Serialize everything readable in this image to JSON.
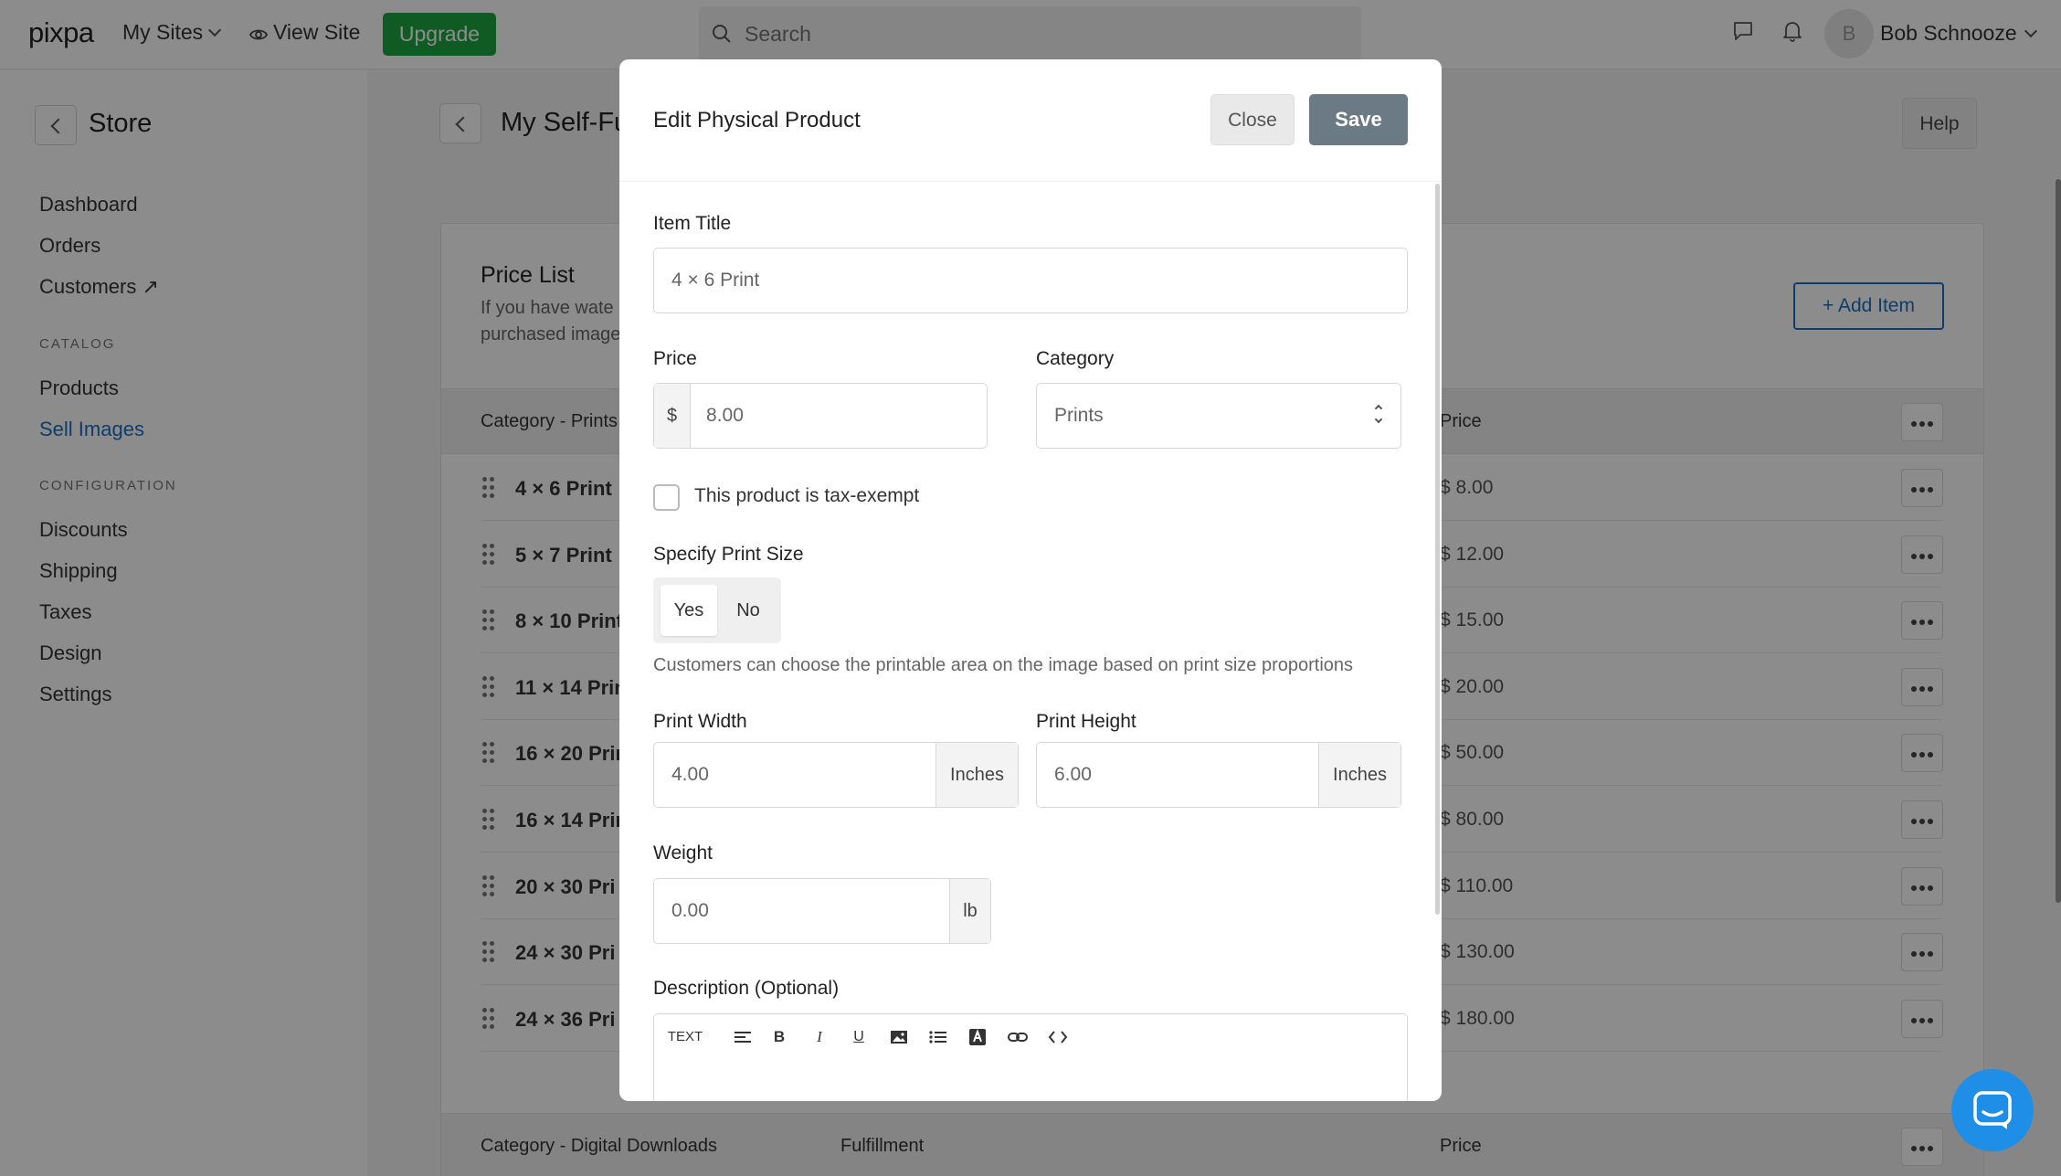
{
  "topbar": {
    "logo": "pixpa",
    "my_sites": "My Sites",
    "view_site": "View Site",
    "upgrade": "Upgrade",
    "search_placeholder": "Search",
    "avatar_initial": "B",
    "user_name": "Bob Schnooze"
  },
  "sidebar": {
    "title": "Store",
    "items_top": [
      "Dashboard",
      "Orders",
      "Customers ↗"
    ],
    "catalog_heading": "CATALOG",
    "catalog_items": [
      "Products",
      "Sell Images"
    ],
    "config_heading": "CONFIGURATION",
    "config_items": [
      "Discounts",
      "Shipping",
      "Taxes",
      "Design",
      "Settings"
    ]
  },
  "main": {
    "title": "My Self-Fu",
    "help": "Help",
    "price_list_title": "Price List",
    "price_list_desc_1": "If you have wate",
    "price_list_desc_2": "purchased image",
    "add_item": "+ Add Item",
    "table1": {
      "col_category": "Category - Prints",
      "col_price": "Price",
      "rows": [
        {
          "name": "4 × 6 Print",
          "price": "$ 8.00"
        },
        {
          "name": "5 × 7 Print",
          "price": "$ 12.00"
        },
        {
          "name": "8 × 10 Print",
          "price": "$ 15.00"
        },
        {
          "name": "11 × 14 Prin",
          "price": "$ 20.00"
        },
        {
          "name": "16 × 20 Prin",
          "price": "$ 50.00"
        },
        {
          "name": "16 × 14 Prin",
          "price": "$ 80.00"
        },
        {
          "name": "20 × 30 Pri",
          "price": "$ 110.00"
        },
        {
          "name": "24 × 30 Pri",
          "price": "$ 130.00"
        },
        {
          "name": "24 × 36 Pri",
          "price": "$ 180.00"
        }
      ]
    },
    "table2": {
      "col_category": "Category - Digital Downloads",
      "col_fulfillment": "Fulfillment",
      "col_price": "Price"
    }
  },
  "modal": {
    "title": "Edit Physical Product",
    "close": "Close",
    "save": "Save",
    "item_title_label": "Item Title",
    "item_title_value": "4 × 6 Print",
    "price_label": "Price",
    "currency": "$",
    "price_value": "8.00",
    "category_label": "Category",
    "category_value": "Prints",
    "tax_exempt_label": "This product is tax-exempt",
    "tax_exempt_checked": false,
    "print_size_label": "Specify Print Size",
    "print_size_yes": "Yes",
    "print_size_no": "No",
    "print_size_selected": "Yes",
    "print_size_hint": "Customers can choose the printable area on the image based on print size proportions",
    "print_width_label": "Print Width",
    "print_width_value": "4.00",
    "print_height_label": "Print Height",
    "print_height_value": "6.00",
    "unit_inches": "Inches",
    "weight_label": "Weight",
    "weight_value": "0.00",
    "weight_unit": "lb",
    "description_label": "Description (Optional)",
    "toolbar_text": "TEXT"
  },
  "colors": {
    "brand_green": "#1ea642",
    "link_blue": "#1a6fc4",
    "save_gray": "#6c7a85",
    "chat_blue": "#1e8ee6"
  }
}
